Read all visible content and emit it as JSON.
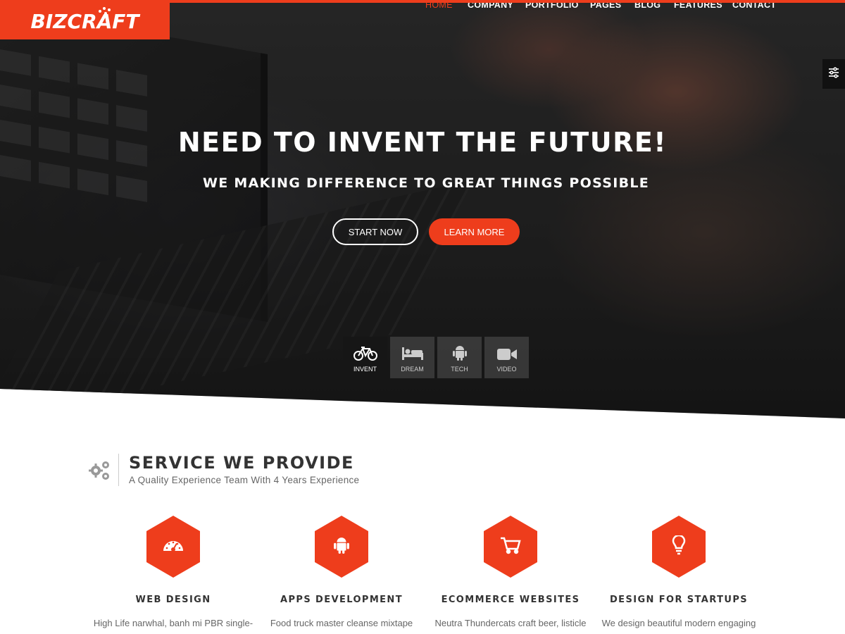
{
  "brand": {
    "logo_text": "BizCraft",
    "accent_color": "#ee3d1c"
  },
  "nav": {
    "items": [
      {
        "label": "HOME",
        "active": true
      },
      {
        "label": "COMPANY"
      },
      {
        "label": "PORTFOLIO"
      },
      {
        "label": "PAGES"
      },
      {
        "label": "BLOG"
      },
      {
        "label": "FEATURES"
      },
      {
        "label": "CONTACT"
      }
    ]
  },
  "settings_panel": {
    "icon": "sliders-icon"
  },
  "hero": {
    "title": "NEED TO INVENT THE FUTURE!",
    "subtitle": "WE MAKING DIFFERENCE TO GREAT THINGS POSSIBLE",
    "primary_button": "START NOW",
    "secondary_button": "LEARN MORE",
    "tabs": [
      {
        "label": "INVENT",
        "icon": "bicycle-icon",
        "active": true
      },
      {
        "label": "DREAM",
        "icon": "bed-icon"
      },
      {
        "label": "TECH",
        "icon": "android-icon"
      },
      {
        "label": "VIDEO",
        "icon": "video-camera-icon"
      }
    ]
  },
  "services": {
    "icon": "gears-icon",
    "title": "SERVICE WE PROVIDE",
    "subtitle": "A Quality Experience Team With 4 Years Experience",
    "items": [
      {
        "title": "WEB DESIGN",
        "text": "High Life narwhal, banh mi PBR single-",
        "icon": "dashboard-icon"
      },
      {
        "title": "APPS DEVELOPMENT",
        "text": "Food truck master cleanse mixtape",
        "icon": "android-icon"
      },
      {
        "title": "ECOMMERCE WEBSITES",
        "text": "Neutra Thundercats craft beer, listicle",
        "icon": "shopping-cart-icon"
      },
      {
        "title": "DESIGN FOR STARTUPS",
        "text": "We design beautiful modern engaging",
        "icon": "lightbulb-icon"
      }
    ]
  }
}
